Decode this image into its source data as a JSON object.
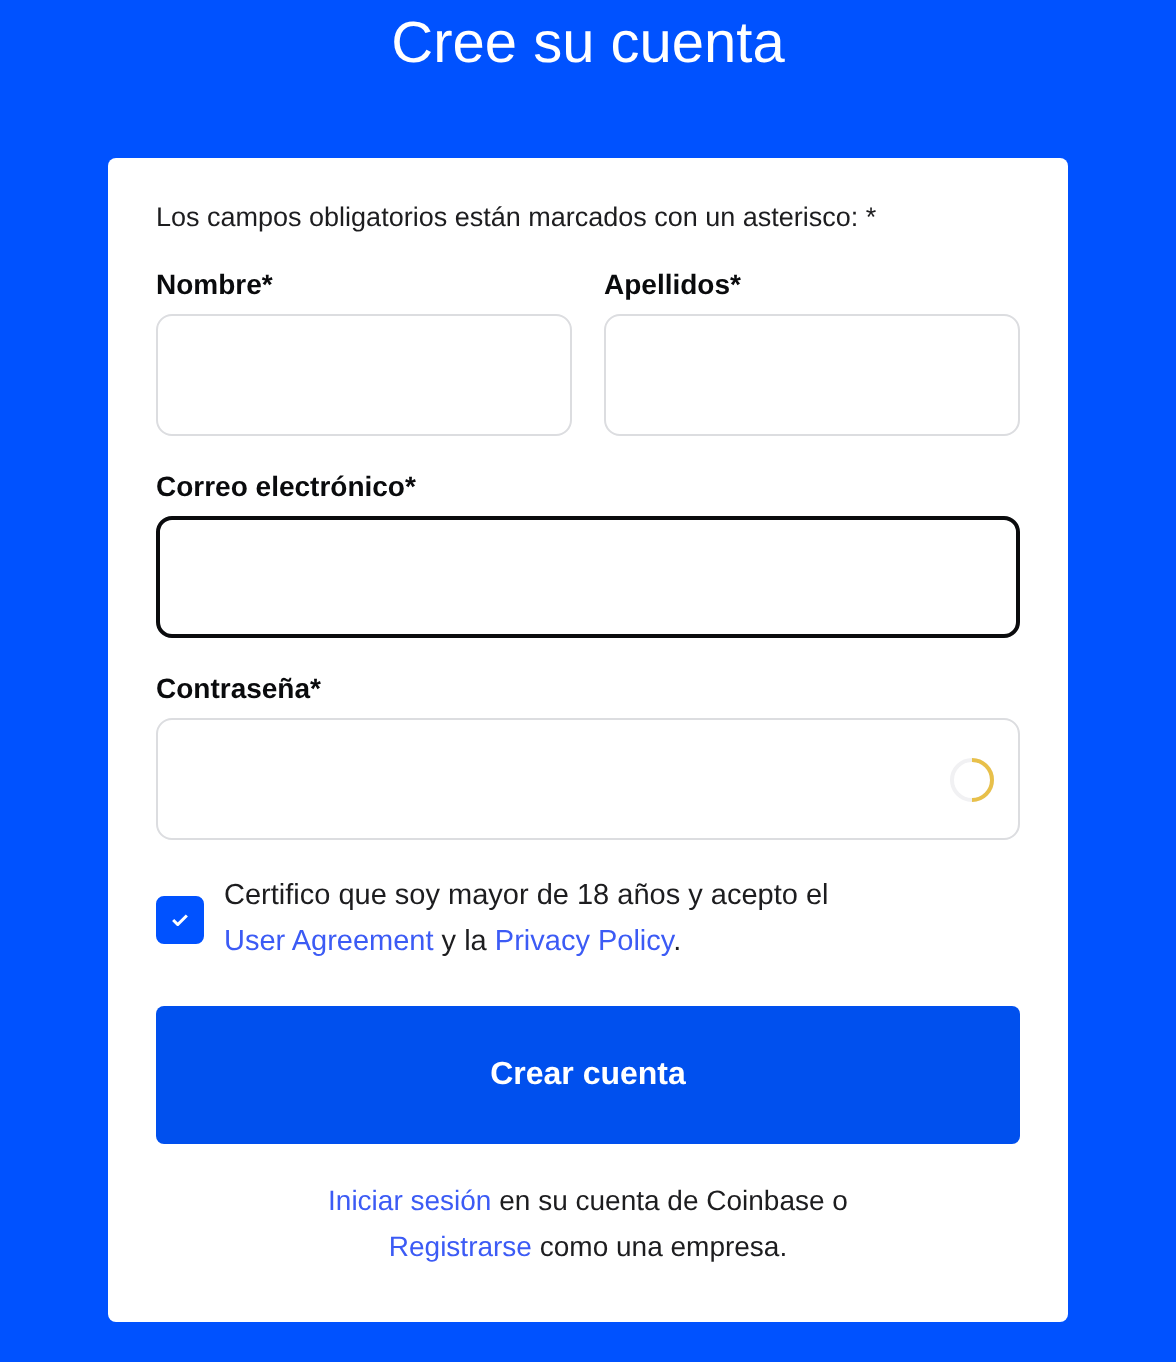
{
  "title": "Cree su cuenta",
  "note": "Los campos obligatorios están marcados con un asterisco: *",
  "field_rows": [
    [
      {
        "label": "Nombre*",
        "focused": false,
        "loading": false
      },
      {
        "label": "Apellidos*",
        "focused": false,
        "loading": false
      }
    ],
    [
      {
        "label": "Correo electrónico*",
        "focused": true,
        "loading": false
      }
    ],
    [
      {
        "label": "Contraseña*",
        "focused": false,
        "loading": true
      }
    ]
  ],
  "consent": {
    "checked": true,
    "before": "Certifico que soy mayor de 18 años y acepto el ",
    "link_1": "User Agreement",
    "middle": " y la ",
    "link_2": "Privacy Policy",
    "after": "."
  },
  "submit": "Crear cuenta",
  "footer": [
    {
      "link": "Iniciar sesión",
      "rest": " en su cuenta de Coinbase o"
    },
    {
      "link": "Registrarse",
      "rest": " como una empresa."
    }
  ]
}
